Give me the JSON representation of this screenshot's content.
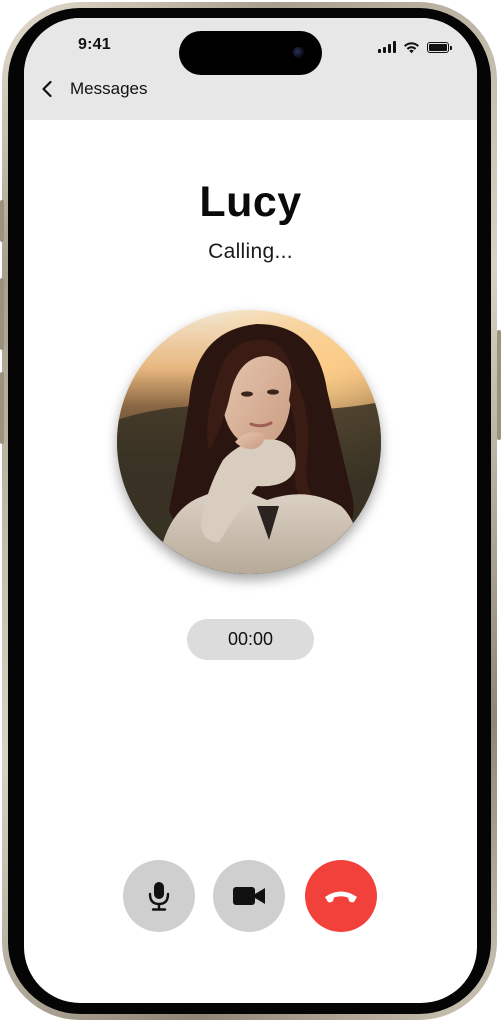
{
  "status_bar": {
    "time": "9:41",
    "icons": [
      "cellular-signal-icon",
      "wifi-icon",
      "battery-icon"
    ]
  },
  "nav": {
    "back_label": "Messages",
    "back_icon": "chevron-left-icon"
  },
  "call": {
    "caller_name": "Lucy",
    "status": "Calling...",
    "duration": "00:00",
    "avatar_icon": "caller-photo"
  },
  "controls": [
    {
      "name": "mute-button",
      "icon": "microphone-icon",
      "color": "#cfcfcf"
    },
    {
      "name": "video-button",
      "icon": "video-camera-icon",
      "color": "#cfcfcf"
    },
    {
      "name": "end-call-button",
      "icon": "hang-up-phone-icon",
      "color": "#f2403b"
    }
  ],
  "colors": {
    "top_bar": "#e7e7e7",
    "end_call": "#f2403b",
    "control_gray": "#cfcfcf",
    "timer_pill": "#dcdcdc"
  }
}
